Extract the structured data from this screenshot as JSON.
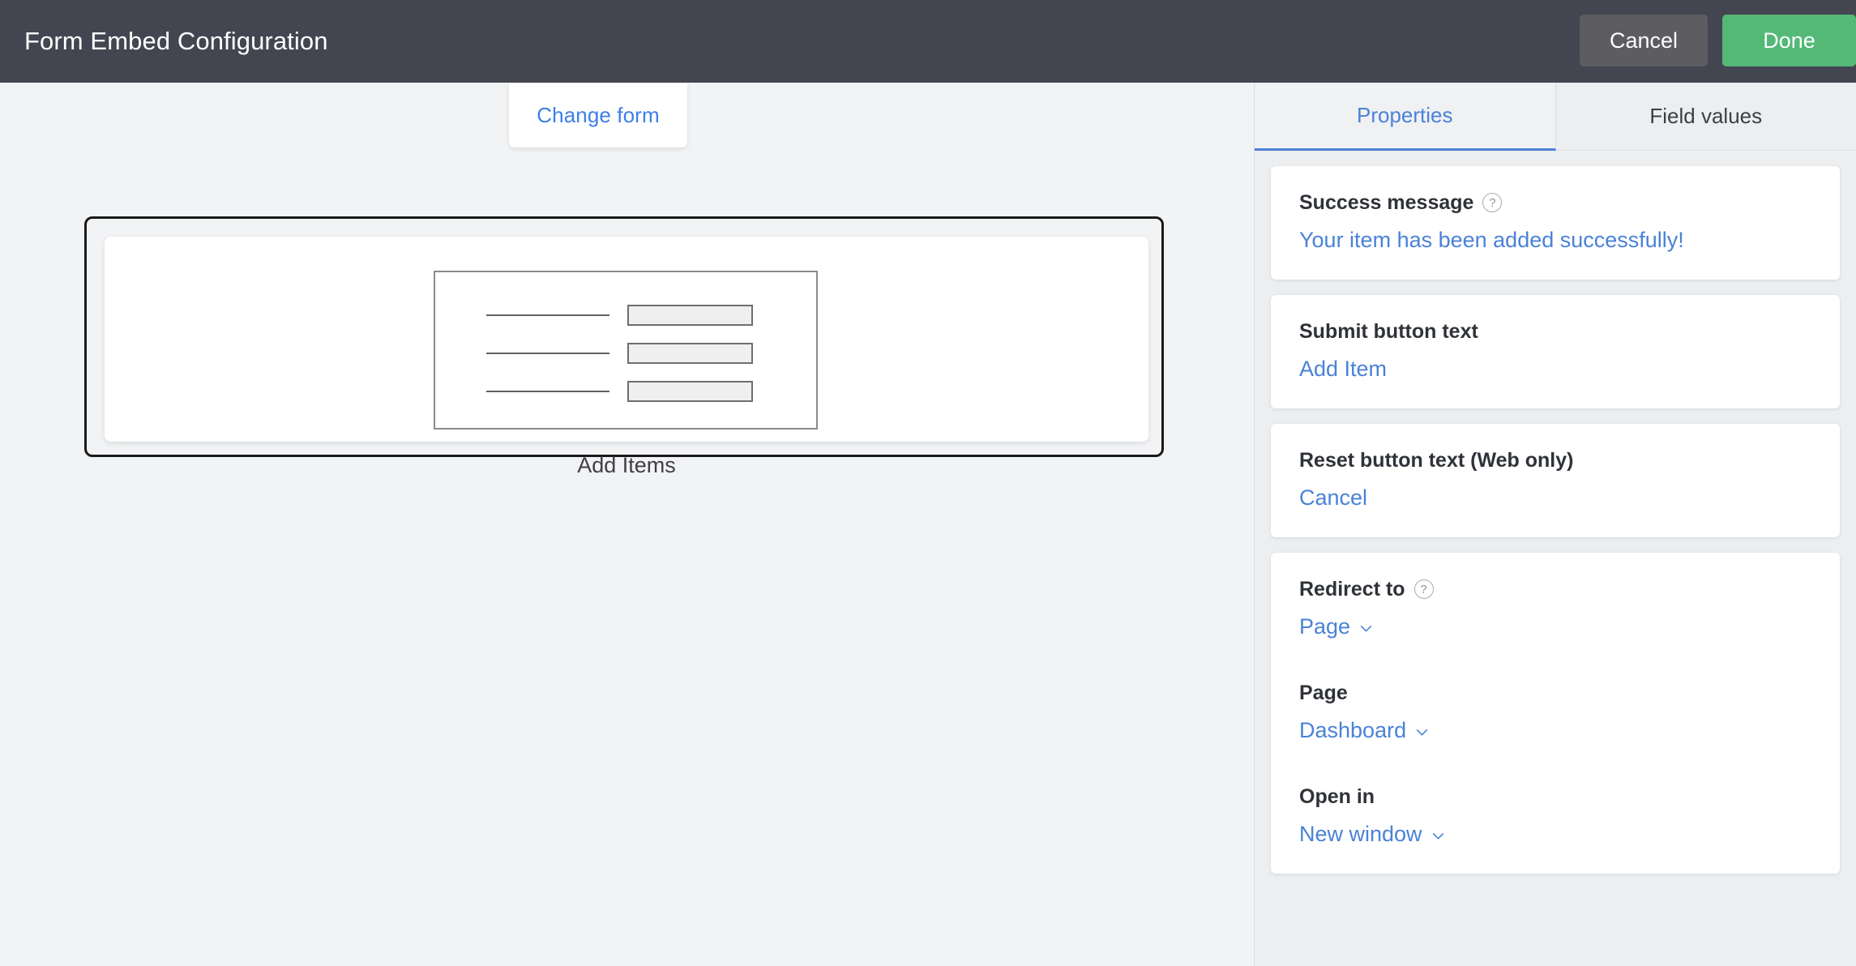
{
  "header": {
    "title": "Form Embed Configuration",
    "cancel_label": "Cancel",
    "done_label": "Done"
  },
  "canvas": {
    "change_form_label": "Change form",
    "preview": {
      "caption": "Add Items",
      "illustration_name": "form-wireframe"
    }
  },
  "panel": {
    "tabs": [
      {
        "label": "Properties",
        "active": true
      },
      {
        "label": "Field values",
        "active": false
      }
    ],
    "cards": [
      {
        "fields": [
          {
            "label": "Success message",
            "help": true,
            "value": "Your item has been added successfully!",
            "dropdown": false
          }
        ]
      },
      {
        "fields": [
          {
            "label": "Submit button text",
            "help": false,
            "value": "Add Item",
            "dropdown": false
          }
        ]
      },
      {
        "fields": [
          {
            "label": "Reset button text (Web only)",
            "help": false,
            "value": "Cancel",
            "dropdown": false
          }
        ]
      },
      {
        "fields": [
          {
            "label": "Redirect to",
            "help": true,
            "value": "Page",
            "dropdown": true
          },
          {
            "label": "Page",
            "help": false,
            "value": "Dashboard",
            "dropdown": true
          },
          {
            "label": "Open in",
            "help": false,
            "value": "New window",
            "dropdown": true
          }
        ]
      }
    ],
    "help_glyph": "?"
  },
  "colors": {
    "header_bg": "#434650",
    "accent_blue": "#4a82d6",
    "done_green": "#54b877",
    "cancel_gray": "#5c5c61"
  }
}
